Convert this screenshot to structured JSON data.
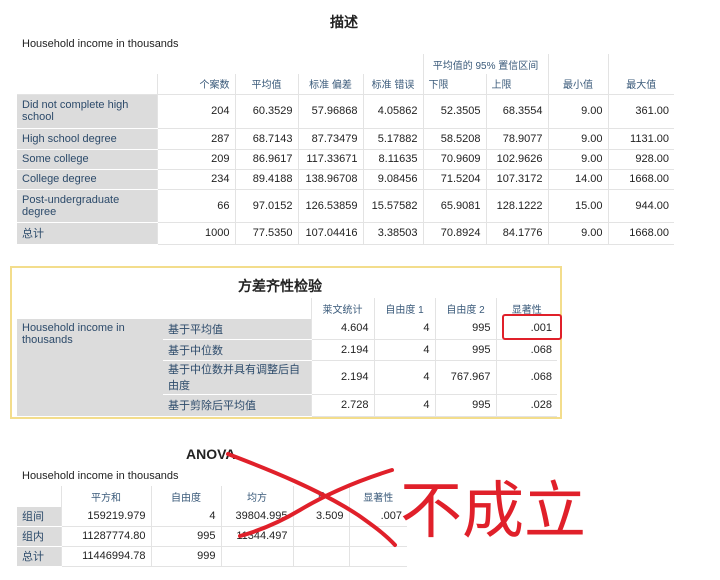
{
  "descriptives": {
    "title": "描述",
    "subtitle": "Household income in thousands",
    "ci_header": "平均值的 95% 置信区间",
    "columns": [
      "个案数",
      "平均值",
      "标准 偏差",
      "标准 错误",
      "下限",
      "上限",
      "最小值",
      "最大值"
    ],
    "rows": [
      {
        "label": "Did not complete high school",
        "values": [
          "204",
          "60.3529",
          "57.96868",
          "4.05862",
          "52.3505",
          "68.3554",
          "9.00",
          "361.00"
        ]
      },
      {
        "label": "High school degree",
        "values": [
          "287",
          "68.7143",
          "87.73479",
          "5.17882",
          "58.5208",
          "78.9077",
          "9.00",
          "1131.00"
        ]
      },
      {
        "label": "Some college",
        "values": [
          "209",
          "86.9617",
          "117.33671",
          "8.11635",
          "70.9609",
          "102.9626",
          "9.00",
          "928.00"
        ]
      },
      {
        "label": "College degree",
        "values": [
          "234",
          "89.4188",
          "138.96708",
          "9.08456",
          "71.5204",
          "107.3172",
          "14.00",
          "1668.00"
        ]
      },
      {
        "label": "Post-undergraduate degree",
        "values": [
          "66",
          "97.0152",
          "126.53859",
          "15.57582",
          "65.9081",
          "128.1222",
          "15.00",
          "944.00"
        ]
      },
      {
        "label": "总计",
        "values": [
          "1000",
          "77.5350",
          "107.04416",
          "3.38503",
          "70.8924",
          "84.1776",
          "9.00",
          "1668.00"
        ]
      }
    ]
  },
  "homogeneity": {
    "title": "方差齐性检验",
    "variable": "Household income in thousands",
    "columns": [
      "莱文统计",
      "自由度 1",
      "自由度 2",
      "显著性"
    ],
    "rows": [
      {
        "label": "基于平均值",
        "values": [
          "4.604",
          "4",
          "995",
          ".001"
        ]
      },
      {
        "label": "基于中位数",
        "values": [
          "2.194",
          "4",
          "995",
          ".068"
        ]
      },
      {
        "label": "基于中位数并具有调整后自由度",
        "values": [
          "2.194",
          "4",
          "767.967",
          ".068"
        ]
      },
      {
        "label": "基于剪除后平均值",
        "values": [
          "2.728",
          "4",
          "995",
          ".028"
        ]
      }
    ]
  },
  "anova": {
    "title": "ANOVA",
    "subtitle": "Household income in thousands",
    "columns": [
      "平方和",
      "自由度",
      "均方",
      "F",
      "显著性"
    ],
    "rows": [
      {
        "label": "组间",
        "values": [
          "159219.979",
          "4",
          "39804.995",
          "3.509",
          ".007"
        ]
      },
      {
        "label": "组内",
        "values": [
          "11287774.80",
          "995",
          "11344.497",
          "",
          ""
        ]
      },
      {
        "label": "总计",
        "values": [
          "11446994.78",
          "999",
          "",
          "",
          ""
        ]
      }
    ]
  },
  "annotation": {
    "text": "不成立",
    "color": "#e0202a"
  }
}
